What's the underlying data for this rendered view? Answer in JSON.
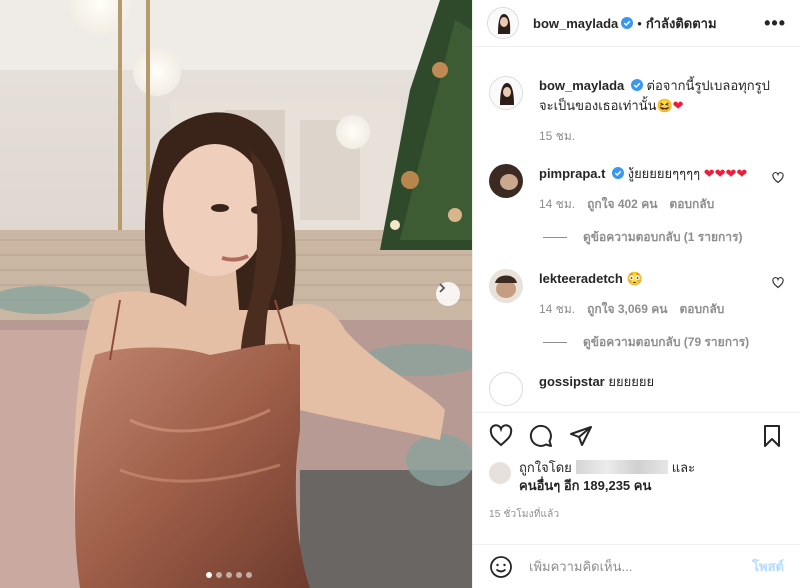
{
  "post": {
    "carousel": {
      "slide_count": 5,
      "active_index": 0
    }
  },
  "header": {
    "username": "bow_maylada",
    "separator": "•",
    "follow_status": "กำลังติดตาม",
    "more_label": "•••"
  },
  "caption": {
    "username": "bow_maylada",
    "text": "ต่อจากนี้รูปเบลอทุกรูปจะเป็นของเธอเท่านั้น",
    "emoji": "😆❤",
    "time": "15 ชม."
  },
  "comments": [
    {
      "username": "pimprapa.t",
      "text": "งู้ยยยยยๆๆๆๆ",
      "emoji": "❤❤❤❤",
      "time": "14 ชม.",
      "likes": "ถูกใจ 402 คน",
      "reply_label": "ตอบกลับ",
      "view_replies": "ดูข้อความตอบกลับ (1 รายการ)"
    },
    {
      "username": "lekteeradetch",
      "text": "",
      "emoji": "😳",
      "time": "14 ชม.",
      "likes": "ถูกใจ 3,069 คน",
      "reply_label": "ตอบกลับ",
      "view_replies": "ดูข้อความตอบกลับ (79 รายการ)"
    },
    {
      "username": "gossipstar",
      "text": "ยยยยยย"
    }
  ],
  "likes": {
    "liked_by_prefix": "ถูกใจโดย",
    "and_label": "และ",
    "others_text": "คนอื่นๆ อีก 189,235 คน"
  },
  "post_time": "15 ชั่วโมงที่แล้ว",
  "comment_box": {
    "placeholder": "เพิ่มความคิดเห็น...",
    "post_label": "โพสต์"
  },
  "colors": {
    "verified": "#3897f0",
    "link_disabled": "#b3dbff",
    "meta_gray": "#8e8e8e",
    "dress": "#a96b54"
  }
}
